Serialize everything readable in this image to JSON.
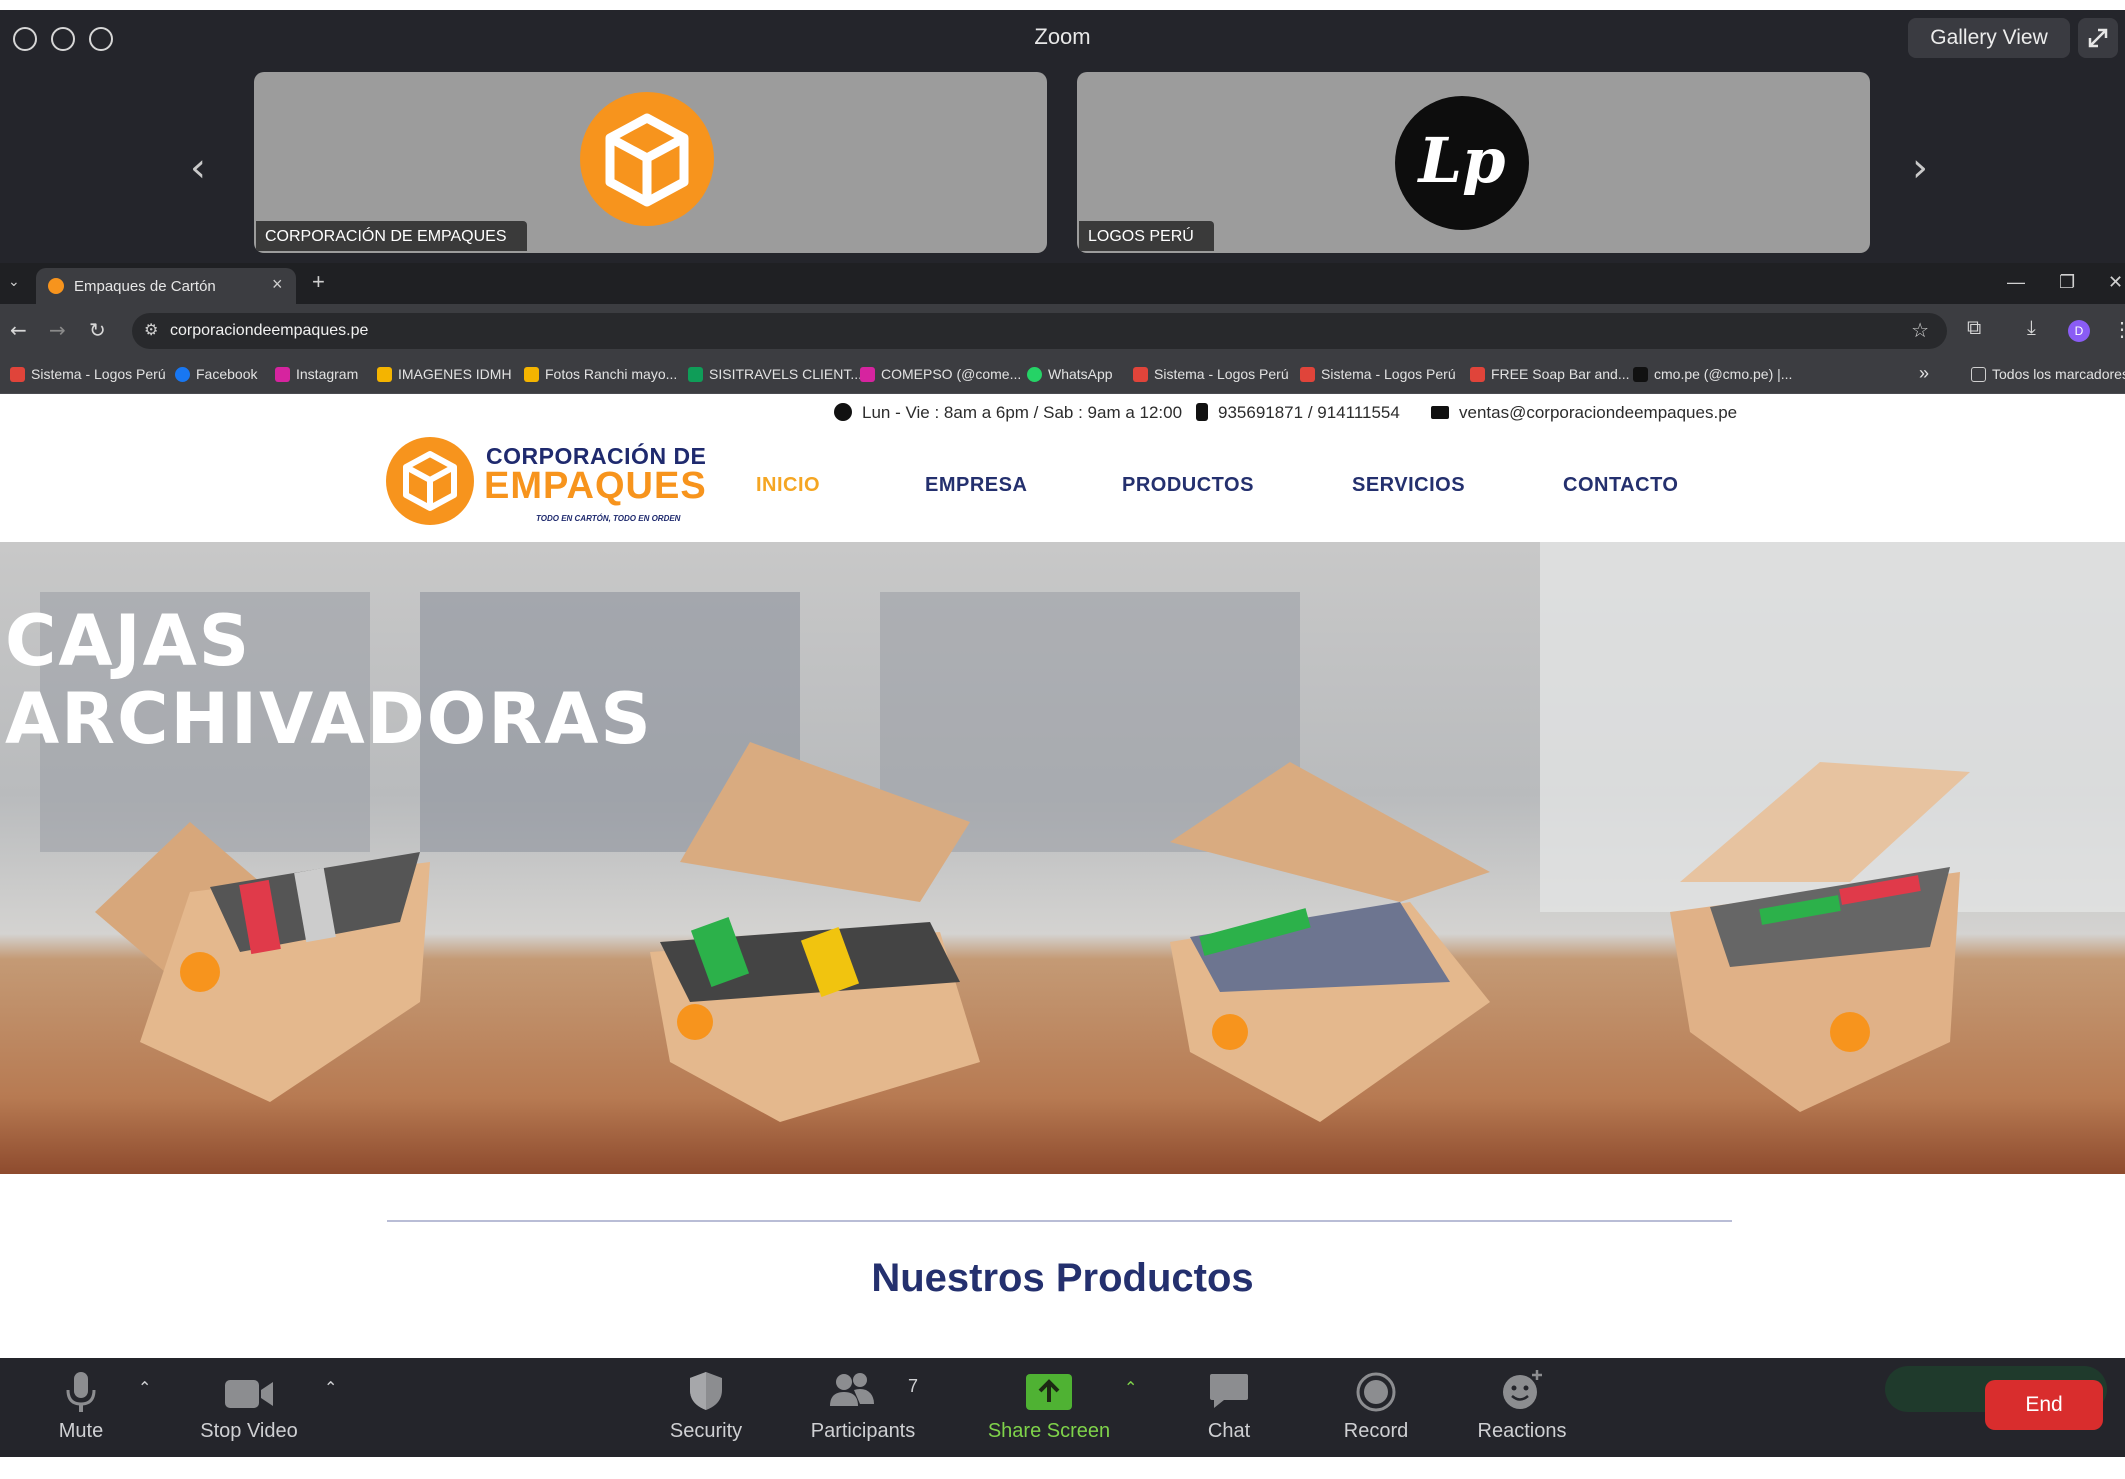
{
  "zoom": {
    "window_title": "Zoom",
    "view_button": "Gallery View",
    "participants_tiles": [
      {
        "name": "CORPORACIÓN DE EMPAQUES"
      },
      {
        "name": "LOGOS PERÚ",
        "avatar_text": "Lp"
      }
    ],
    "toolbar": {
      "mute": "Mute",
      "stop_video": "Stop Video",
      "security": "Security",
      "participants": "Participants",
      "participants_count": "7",
      "share_screen": "Share Screen",
      "chat": "Chat",
      "record": "Record",
      "reactions": "Reactions",
      "end": "End",
      "share_color": "#7fd34a",
      "end_color": "#d92d2d"
    }
  },
  "browser": {
    "tab_title": "Empaques de Cartón",
    "url": "corporaciondeempaques.pe",
    "profile_initial": "D",
    "bookmarks": [
      {
        "label": "Sistema - Logos Perú",
        "icon_color": "#e0443a"
      },
      {
        "label": "Facebook",
        "icon_color": "#1877f2"
      },
      {
        "label": "Instagram",
        "icon_color": "#d6249f"
      },
      {
        "label": "IMAGENES IDMH",
        "icon_color": "#f4b400"
      },
      {
        "label": "Fotos Ranchi mayo...",
        "icon_color": "#f4b400"
      },
      {
        "label": "SISITRAVELS CLIENT...",
        "icon_color": "#0f9d58"
      },
      {
        "label": "COMEPSO (@come...",
        "icon_color": "#d6249f"
      },
      {
        "label": "WhatsApp",
        "icon_color": "#25d366"
      },
      {
        "label": "Sistema - Logos Perú",
        "icon_color": "#e0443a"
      },
      {
        "label": "Sistema - Logos Perú",
        "icon_color": "#e0443a"
      },
      {
        "label": "FREE Soap Bar and...",
        "icon_color": "#e0443a"
      },
      {
        "label": "cmo.pe (@cmo.pe) |...",
        "icon_color": "#111111"
      }
    ],
    "bookmarks_overflow": "»",
    "all_bookmarks": "Todos los marcadores"
  },
  "site": {
    "hours": "Lun - Vie : 8am a 6pm / Sab : 9am a 12:00",
    "phones": "935691871 / 914111554",
    "email": "ventas@corporaciondeempaques.pe",
    "logo": {
      "line1": "CORPORACIÓN DE",
      "line2": "EMPAQUES",
      "tagline": "TODO EN CARTÓN, TODO EN ORDEN"
    },
    "menu": [
      "INICIO",
      "EMPRESA",
      "PRODUCTOS",
      "SERVICIOS",
      "CONTACTO"
    ],
    "hero": {
      "line1": "CAJAS",
      "line2": "ARCHIVADORAS"
    },
    "section_title": "Nuestros Productos",
    "brand_orange": "#f7941d",
    "brand_navy": "#24306e"
  }
}
